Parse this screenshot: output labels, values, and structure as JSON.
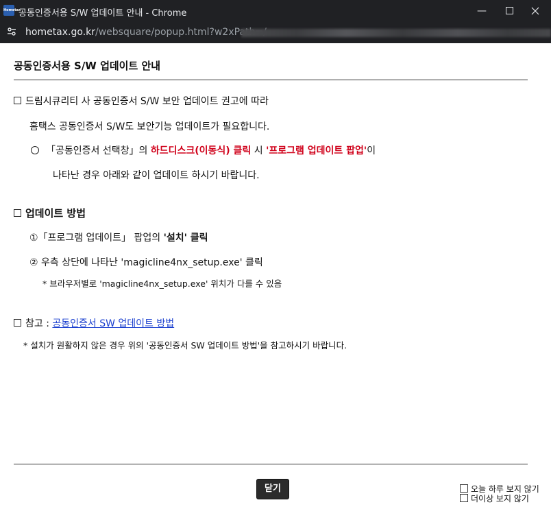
{
  "window": {
    "title": "공동인증서용 S/W 업데이트 안내 - Chrome",
    "app_icon_text": "Hometax",
    "minimize_icon": "minimize-icon",
    "maximize_icon": "maximize-icon",
    "close_icon": "close-icon"
  },
  "address_bar": {
    "domain": "hometax.go.kr",
    "path": "/websquare/popup.html?w2xPath=/"
  },
  "popup": {
    "title": "공동인증서용 S/W 업데이트 안내",
    "section1": {
      "line1": "드림시큐리티 사 공동인증서 S/W 보안 업데이트 권고에 따라",
      "line2": "홈택스 공동인증서 S/W도 보안기능 업데이트가 필요합니다.",
      "line3_pre": "「공동인증서 선택창」의 ",
      "line3_red1": "하드디스크(이동식) 클릭",
      "line3_mid": " 시 ",
      "line3_red2": "'프로그램 업데이트 팝업'",
      "line3_post": "이",
      "line4": "나타난 경우  아래와 같이 업데이트 하시기 바랍니다."
    },
    "section2": {
      "heading": "업데이트 방법",
      "step1_pre": "①「프로그램 업데이트」 팝업의 ",
      "step1_bold": "'설치' 클릭",
      "step2": "② 우측 상단에 나타난 'magicline4nx_setup.exe' 클릭",
      "step2_note": "* 브라우저별로 'magicline4nx_setup.exe' 위치가 다를 수 있음"
    },
    "section3": {
      "label": "참고 : ",
      "link": "공동인증서 SW 업데이트 방법",
      "note": "* 설치가 원활하지 않은 경우 위의 '공동인증서 SW 업데이트 방법'을 참고하시기 바랍니다."
    },
    "close_button": "닫기",
    "checkbox_today": "오늘 하루 보지 않기",
    "checkbox_never": "더이상 보지 않기"
  }
}
